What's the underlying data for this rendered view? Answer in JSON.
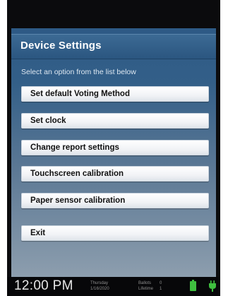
{
  "header": {
    "title": "Device Settings"
  },
  "instruction": "Select an option from the list below",
  "menu": [
    {
      "label": "Set default Voting Method"
    },
    {
      "label": "Set clock"
    },
    {
      "label": "Change report settings"
    },
    {
      "label": "Touchscreen calibration"
    },
    {
      "label": "Paper sensor calibration"
    },
    {
      "label": "Exit"
    }
  ],
  "status": {
    "time": "12:00 PM",
    "day": "Thursday",
    "date": "1/16/2020",
    "ballots_label": "Ballots",
    "ballots_value": "0",
    "lifetime_label": "Lifetime",
    "lifetime_value": "1"
  },
  "colors": {
    "header_bg": "#2f5c88",
    "battery": "#3fbf3f",
    "plug": "#3fbf3f"
  }
}
